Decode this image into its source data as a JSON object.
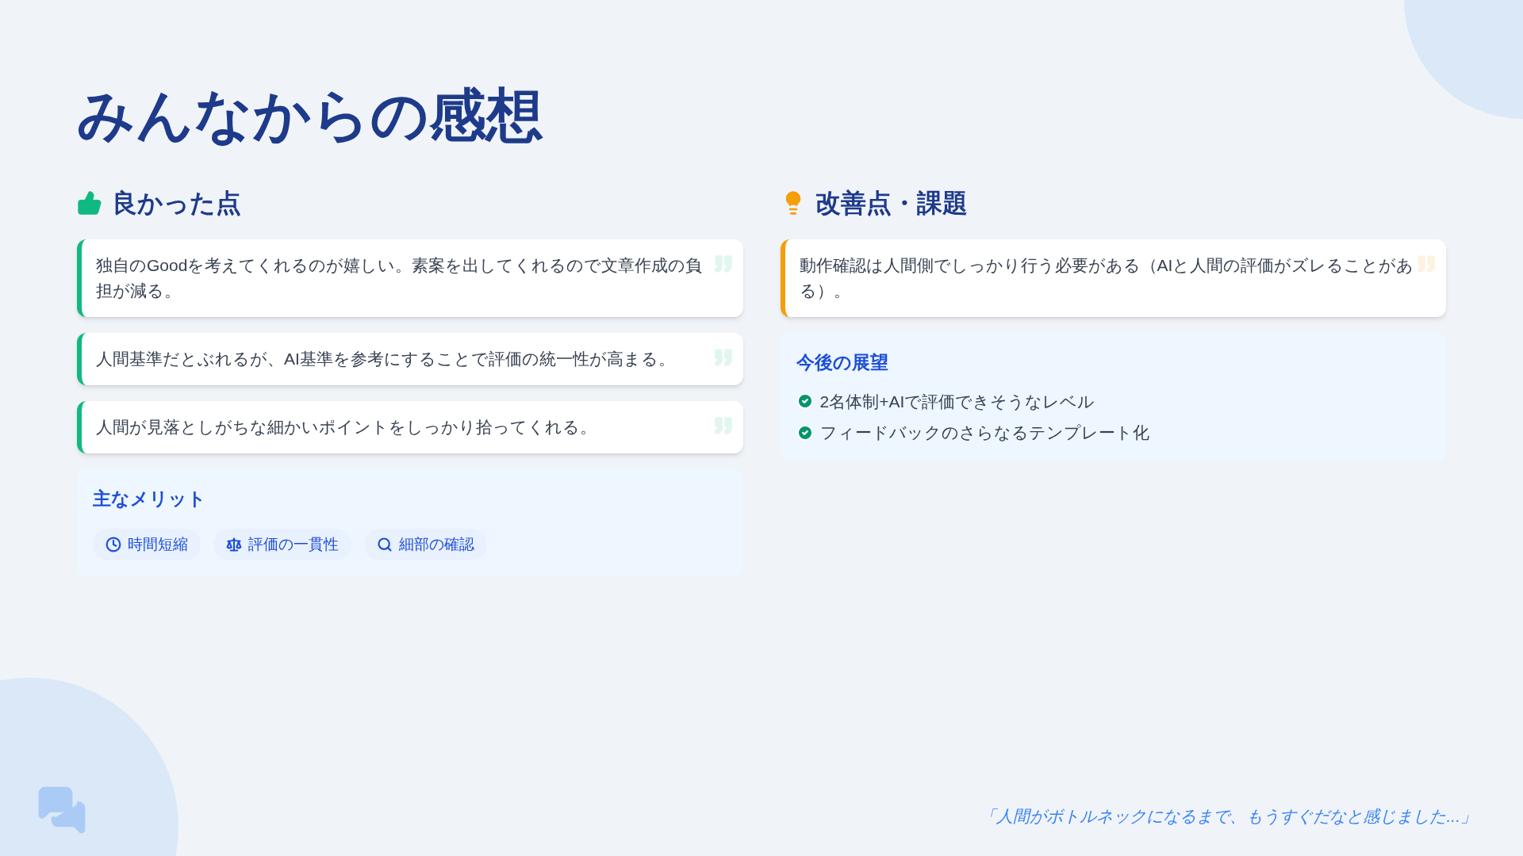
{
  "title": "みんなからの感想",
  "sections": [
    {
      "heading": "良かった点",
      "color": "#10b981",
      "cards": [
        {
          "text": "独自のGoodを考えてくれるのが嬉しい。素案を出してくれるので文章作成の負担が減る。"
        },
        {
          "text": "人間基準だとぶれるが、AI基準を参考にすることで評価の統一性が高まる。"
        },
        {
          "text": "人間が見落としがちな細かいポイントをしっかり拾ってくれる。"
        }
      ],
      "panel": {
        "kind": "chips",
        "heading": "主なメリット",
        "items": [
          "時間短縮",
          "評価の一貫性",
          "細部の確認"
        ]
      }
    },
    {
      "heading": "改善点・課題",
      "color": "#f59e0b",
      "cards": [
        {
          "text": "動作確認は人間側でしっかり行う必要がある（AIと人間の評価がズレることがある）。"
        }
      ],
      "panel": {
        "kind": "checklist",
        "heading": "今後の展望",
        "items": [
          "2名体制+AIで評価できそうなレベル",
          "フィードバックのさらなるテンプレート化"
        ]
      }
    }
  ],
  "footer_quote": "「人間がボトルネックになるまで、もうすぐだなと感じました...」"
}
